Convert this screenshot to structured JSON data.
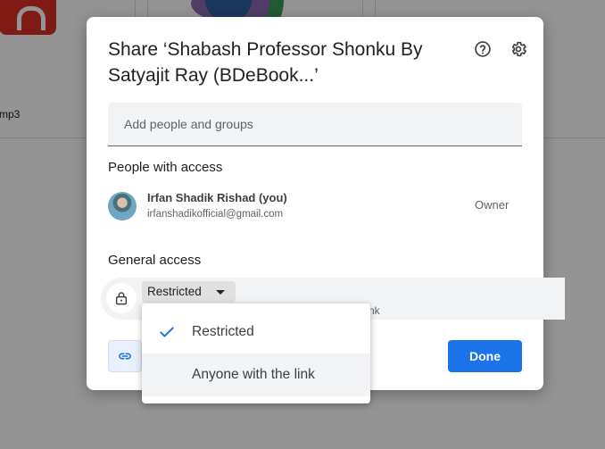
{
  "background": {
    "file_label": "mp3"
  },
  "dialog": {
    "title": "Share ‘Shabash Professor Shonku By Satyajit Ray (BDeBook...’",
    "add_people_placeholder": "Add people and groups",
    "people_heading": "People with access",
    "person": {
      "name": "Irfan Shadik Rishad (you)",
      "email": "irfanshadikofficial@gmail.com",
      "role": "Owner"
    },
    "general_heading": "General access",
    "access_value": "Restricted",
    "access_desc_fragment": "nk",
    "done_label": "Done"
  },
  "menu": {
    "items": [
      {
        "label": "Restricted",
        "selected": true
      },
      {
        "label": "Anyone with the link",
        "selected": false
      }
    ]
  },
  "colors": {
    "accent": "#1a73e8",
    "field_bg": "#f1f3f4"
  },
  "icons": [
    "help-icon",
    "gear-icon",
    "lock-icon",
    "link-icon",
    "check-icon",
    "caret-down-icon"
  ]
}
